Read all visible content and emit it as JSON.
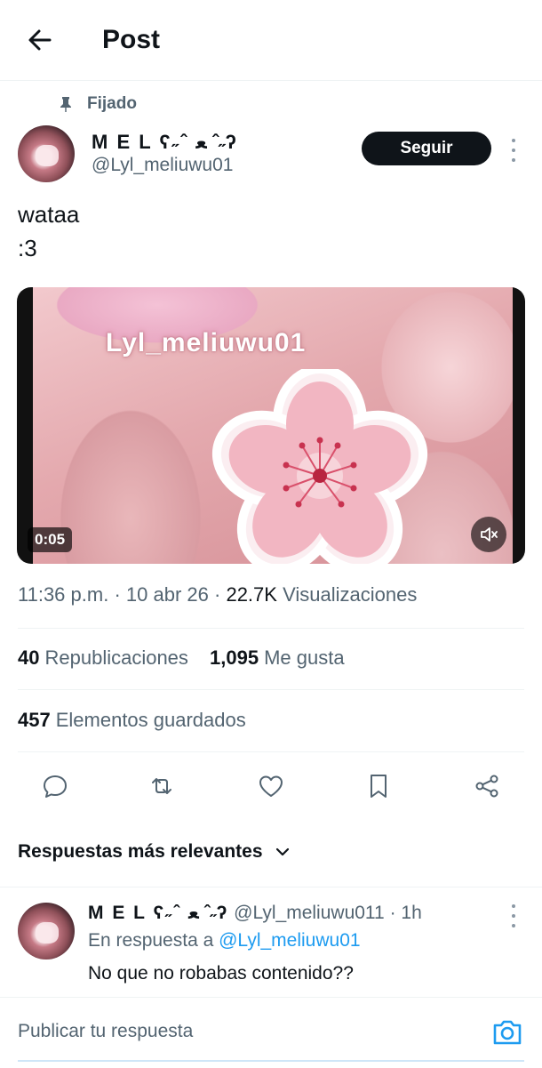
{
  "header": {
    "title": "Post",
    "back_icon": "arrow-left-icon"
  },
  "post": {
    "pinned_label": "Fijado",
    "author_name": "M E L ʕ˶ˆ ﻌ ˆ˶ʔ",
    "author_handle": "@Lyl_meliuwu01",
    "follow_label": "Seguir",
    "text": "wataa\n:3",
    "media": {
      "watermark": "Lyl_meliuwu01",
      "duration": "0:05",
      "mute_icon": "volume-muted-icon"
    },
    "meta": {
      "time": "11:36 p.m.",
      "date": "10 abr 26",
      "views_count": "22.7K",
      "views_label": "Visualizaciones"
    },
    "stats": {
      "reposts_count": "40",
      "reposts_label": "Republicaciones",
      "likes_count": "1,095",
      "likes_label": "Me gusta",
      "bookmarks_count": "457",
      "bookmarks_label": "Elementos guardados"
    },
    "actions": [
      "reply-icon",
      "repost-icon",
      "like-icon",
      "bookmark-icon",
      "share-icon"
    ]
  },
  "replies": {
    "sort_label": "Respuestas más relevantes",
    "items": [
      {
        "name": "M E L ʕ˶ˆ ﻌ ˆ˶ʔ",
        "handle": "@Lyl_meliuwu011",
        "time": "· 1h",
        "in_reply_prefix": "En respuesta a",
        "in_reply_handle": "@Lyl_meliuwu01",
        "text": "No que no robabas contenido??"
      }
    ]
  },
  "composer": {
    "placeholder": "Publicar tu respuesta",
    "camera_icon": "camera-icon"
  },
  "colors": {
    "text": "#0f1419",
    "muted": "#536471",
    "accent": "#1d9bf0",
    "follow_bg": "#0f1419",
    "divider": "#eff3f4"
  }
}
